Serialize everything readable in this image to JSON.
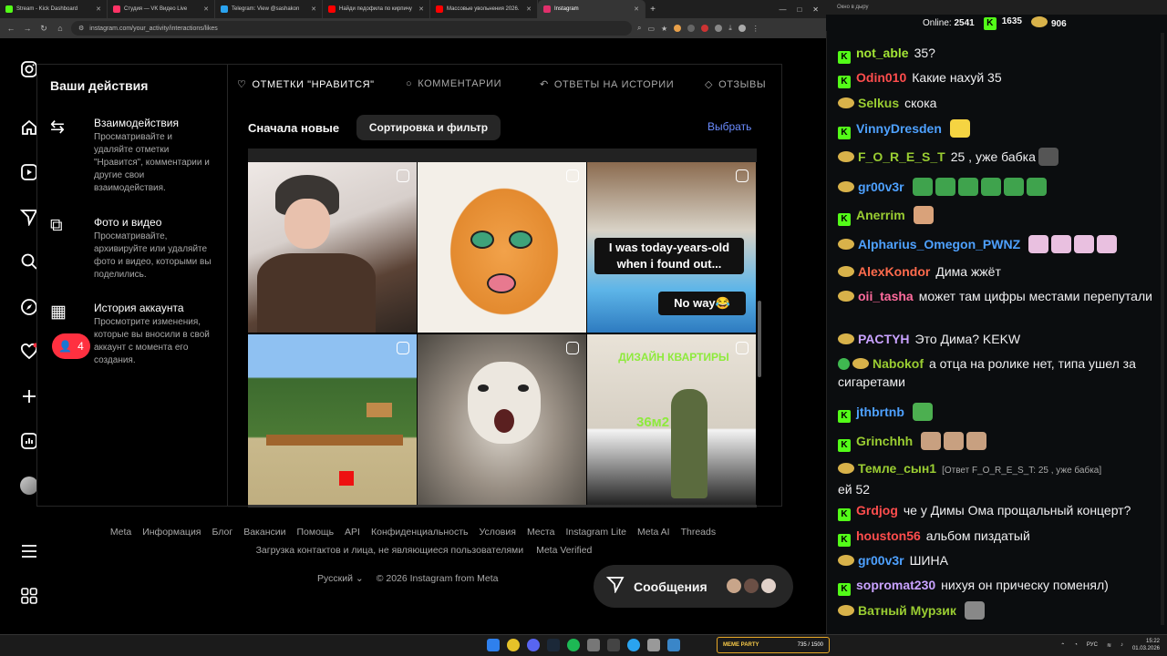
{
  "browser": {
    "tabs": [
      {
        "label": "Stream - Kick Dashboard",
        "color": "#53fc18",
        "active": false
      },
      {
        "label": "Студия — VK Видео Live",
        "color": "#ff3366",
        "active": false
      },
      {
        "label": "Telegram: View @sashakon",
        "color": "#2aa3ef",
        "active": false
      },
      {
        "label": "Найди педофила по кирпичу",
        "color": "#ff0000",
        "active": false
      },
      {
        "label": "Массовые увольнения 2026.",
        "color": "#ff0000",
        "active": false
      },
      {
        "label": "Instagram",
        "color": "#e1306c",
        "active": true
      }
    ],
    "url": "instagram.com/your_activity/interactions/likes"
  },
  "sidebar": {
    "notification_count": "4"
  },
  "activity": {
    "title": "Ваши действия",
    "sections": [
      {
        "title": "Взаимодействия",
        "desc": "Просматривайте и удаляйте отметки \"Нравится\", комментарии и другие свои взаимодействия.",
        "icon": "arrows-icon"
      },
      {
        "title": "Фото и видео",
        "desc": "Просматривайте, архивируйте или удаляйте фото и видео, которыми вы поделились.",
        "icon": "media-icon"
      },
      {
        "title": "История аккаунта",
        "desc": "Просмотрите изменения, которые вы вносили в свой аккаунт с момента его создания.",
        "icon": "calendar-icon"
      }
    ],
    "tabs": [
      "ОТМЕТКИ \"НРАВИТСЯ\"",
      "КОММЕНТАРИИ",
      "ОТВЕТЫ НА ИСТОРИИ",
      "ОТЗЫВЫ"
    ],
    "sort_label": "Сначала новые",
    "filter_button": "Сортировка и фильтр",
    "select_label": "Выбрать",
    "tile_texts": {
      "caption1": "I was today-years-old when i found out...",
      "caption2": "No way😂",
      "design_title": "ДИЗАЙН КВАРТИРЫ",
      "design_size": "36м2"
    }
  },
  "footer": {
    "links": [
      "Meta",
      "Информация",
      "Блог",
      "Вакансии",
      "Помощь",
      "API",
      "Конфиденциальность",
      "Условия",
      "Места",
      "Instagram Lite",
      "Meta AI",
      "Threads"
    ],
    "links2": [
      "Загрузка контактов и лица, не являющиеся пользователями",
      "Meta Verified"
    ],
    "language": "Русский",
    "copyright": "© 2026 Instagram from Meta"
  },
  "messages_button": "Сообщения",
  "chat": {
    "window_title": "Окно в дыру",
    "online_label": "Online:",
    "online": "2541",
    "kick_count": "1635",
    "other_count": "906",
    "messages": [
      {
        "user": "not_able",
        "color": "#a3e635",
        "badge": "K",
        "text": "35?"
      },
      {
        "user": "Odin010",
        "color": "#ff4d4d",
        "badge": "K",
        "text": "Какие нахуй 35"
      },
      {
        "user": "Selkus",
        "color": "#9acd32",
        "badge": "H",
        "text": "скока"
      },
      {
        "user": "VinnyDresden",
        "color": "#4ea1ff",
        "badge": "K",
        "text": ""
      },
      {
        "user": "F_O_R_E_S_T",
        "color": "#9acd32",
        "badge": "H",
        "text": "25 , уже бабка"
      },
      {
        "user": "gr00v3r",
        "color": "#4ea1ff",
        "badge": "H",
        "text": ""
      },
      {
        "user": "Anerrim",
        "color": "#9acd32",
        "badge": "K",
        "text": ""
      },
      {
        "user": "Alpharius_Omegon_PWNZ",
        "color": "#4ea1ff",
        "badge": "H",
        "text": ""
      },
      {
        "user": "AlexKondor",
        "color": "#ff6b4d",
        "badge": "H",
        "text": "Дима жжёт"
      },
      {
        "user": "oii_tasha",
        "color": "#ff6b9d",
        "badge": "H",
        "text": "может там цифры местами перепутали"
      },
      {
        "user": "PACTYH",
        "color": "#c9a2ff",
        "badge": "H",
        "text": "Это Дима? KEKW"
      },
      {
        "user": "Nabokof",
        "color": "#9acd32",
        "badge": "VH",
        "text": "а отца на ролике нет, типа ушел за сигаретами"
      },
      {
        "user": "jthbrtnb",
        "color": "#4ea1ff",
        "badge": "K",
        "text": ""
      },
      {
        "user": "Grinchhh",
        "color": "#9acd32",
        "badge": "K",
        "text": ""
      },
      {
        "user": "Темле_сын1",
        "color": "#9acd32",
        "badge": "H",
        "text": "ей 52",
        "reply": "[Ответ F_O_R_E_S_T: 25 , уже бабка]"
      },
      {
        "user": "Grdjog",
        "color": "#ff4d4d",
        "badge": "K",
        "text": "че у Димы Ома прощальный концерт?"
      },
      {
        "user": "houston56",
        "color": "#ff4d4d",
        "badge": "K",
        "text": "альбом пиздатый"
      },
      {
        "user": "gr00v3r",
        "color": "#4ea1ff",
        "badge": "H",
        "text": "ШИНА"
      },
      {
        "user": "sopromat230",
        "color": "#c9a2ff",
        "badge": "K",
        "text": "нихуя он прическу поменял)"
      },
      {
        "user": "Ватный Мурзик",
        "color": "#9acd32",
        "badge": "H",
        "text": ""
      }
    ]
  },
  "taskbar": {
    "party_label": "MEME PARTY",
    "party_count": "735 / 1500",
    "lang": "РУС",
    "time": "15:22",
    "date": "01.03.2026"
  }
}
